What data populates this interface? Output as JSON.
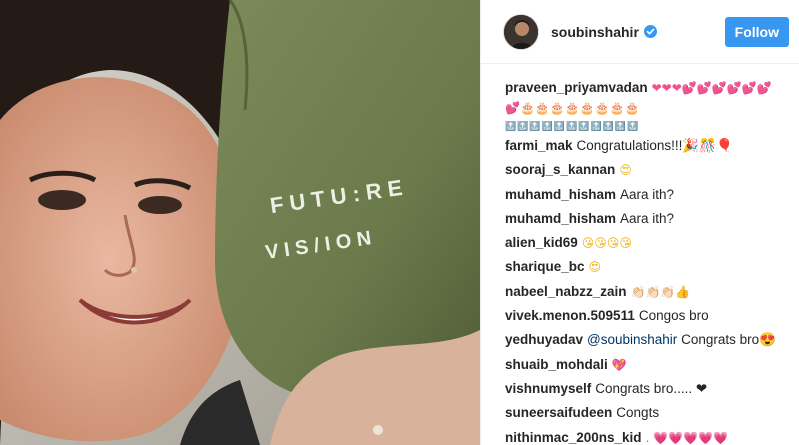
{
  "post": {
    "username": "soubinshahir",
    "follow_label": "Follow"
  },
  "photo": {
    "cap_text_line1": "F U T U : R E",
    "cap_text_line2": "V I S / I O N"
  },
  "comments": [
    {
      "user": "praveen_priyamvadan",
      "text": "❤❤❤💕💕💕💕💕💕",
      "line2": "💕🎂🎂🎂🎂🎂🎂🎂🎂",
      "line3": "🔝🔝🔝🔝🔝🔝🔝🔝🔝🔝🔝"
    },
    {
      "user": "farmi_mak",
      "text": "Congratulations!!!🎉🎊🎈"
    },
    {
      "user": "sooraj_s_kannan",
      "text": "😍"
    },
    {
      "user": "muhamd_hisham",
      "text": "Aara ith?"
    },
    {
      "user": "muhamd_hisham",
      "text": "Aara ith?"
    },
    {
      "user": "alien_kid69",
      "text": "😘😘😘😘"
    },
    {
      "user": "sharique_bc",
      "text": "😍"
    },
    {
      "user": "nabeel_nabzz_zain",
      "text": "👏🏻👏🏻👏🏻👍"
    },
    {
      "user": "vivek.menon.509511",
      "text": "Congos bro"
    },
    {
      "user": "yedhuyadav",
      "mention": "@soubinshahir",
      "text": "Congrats bro😍"
    },
    {
      "user": "shuaib_mohdali",
      "text": "💖"
    },
    {
      "user": "vishnumyself",
      "text": "Congrats bro..... ❤"
    },
    {
      "user": "suneersaifudeen",
      "text": "Congts"
    },
    {
      "user": "nithinmac_200ns_kid",
      "text": ". 💗💗💗💗💗"
    }
  ]
}
